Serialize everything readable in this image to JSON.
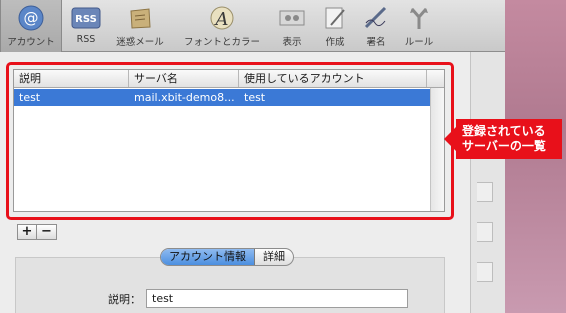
{
  "toolbar": {
    "items": [
      {
        "label": "アカウント",
        "icon": "at-sign-icon"
      },
      {
        "label": "RSS",
        "icon": "rss-icon"
      },
      {
        "label": "迷惑メール",
        "icon": "junk-mail-icon"
      },
      {
        "label": "フォントとカラー",
        "icon": "fonts-colors-icon"
      },
      {
        "label": "表示",
        "icon": "viewing-icon"
      },
      {
        "label": "作成",
        "icon": "composing-icon"
      },
      {
        "label": "署名",
        "icon": "signatures-icon"
      },
      {
        "label": "ルール",
        "icon": "rules-icon"
      }
    ],
    "rss_badge": "RSS"
  },
  "table": {
    "headers": [
      "説明",
      "サーバ名",
      "使用しているアカウント"
    ],
    "rows": [
      {
        "desc": "test",
        "server": "mail.xbit-demo8...",
        "account": "test"
      }
    ]
  },
  "callout": {
    "line1": "登録されている",
    "line2": "サーバーの一覧"
  },
  "buttons": {
    "add": "+",
    "remove": "−"
  },
  "tabs": [
    "アカウント情報",
    "詳細"
  ],
  "form": {
    "desc_label": "説明：",
    "desc_value": "test"
  },
  "colors": {
    "highlight": "#e8101a",
    "selection": "#3b79d6"
  }
}
